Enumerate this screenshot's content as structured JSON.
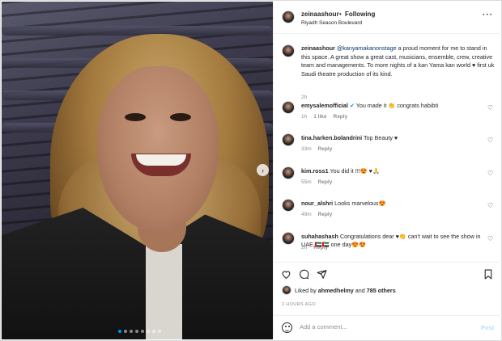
{
  "post": {
    "author": "zeinaashour",
    "separator": "•",
    "follow_label": "Following",
    "location": "Riyadh Season Boulevard",
    "more_icon": "more-horizontal-icon",
    "carousel": {
      "total_slides": 8,
      "active_index": 0
    }
  },
  "caption": {
    "author": "zeinaashour",
    "mention": "@kanyamakanonstage",
    "text": "a proud moment for me to stand in this space. A great show a great cast, musicians, ensemble, crew, creative team and managements. To more nights of a kan Yama kan world ♥ first uk Saudi theatre production of its kind.",
    "time": "2h"
  },
  "comments": [
    {
      "user": "emysalemofficial",
      "text": "You made it 👏 congrats habibti",
      "time": "1h",
      "likes": "1 like",
      "reply": "Reply",
      "verified": true
    },
    {
      "user": "tina.harken.bolandrini",
      "text": "Top Beauty ♥",
      "time": "33m",
      "likes": "",
      "reply": "Reply"
    },
    {
      "user": "kim.ross1",
      "text": "You did it !!!😍 ♥🙏",
      "time": "55m",
      "likes": "",
      "reply": "Reply"
    },
    {
      "user": "nour_alshri",
      "text": "Looks marvelous😍",
      "time": "49m",
      "likes": "",
      "reply": "Reply"
    },
    {
      "user": "suhahashash",
      "text": "Congratulations dear ♥👏 can't wait to see the show in UAE 🇦🇪🇦🇪 one day😍😍",
      "time": "2h",
      "likes": "",
      "reply": "Reply"
    }
  ],
  "actions": {
    "like_icon": "heart-icon",
    "comment_icon": "comment-icon",
    "share_icon": "share-icon",
    "save_icon": "bookmark-icon",
    "liked_by_prefix": "Liked by",
    "liked_by_user": "ahmedhelmy",
    "liked_by_and": "and",
    "liked_by_others": "785 others",
    "timestamp": "2 HOURS AGO"
  },
  "add_comment": {
    "placeholder": "Add a comment...",
    "post_label": "Post"
  },
  "colors": {
    "link": "#00376b",
    "muted": "#8e8e8e",
    "post_button_disabled": "#b2dffc",
    "active_dot": "#0095f6"
  }
}
